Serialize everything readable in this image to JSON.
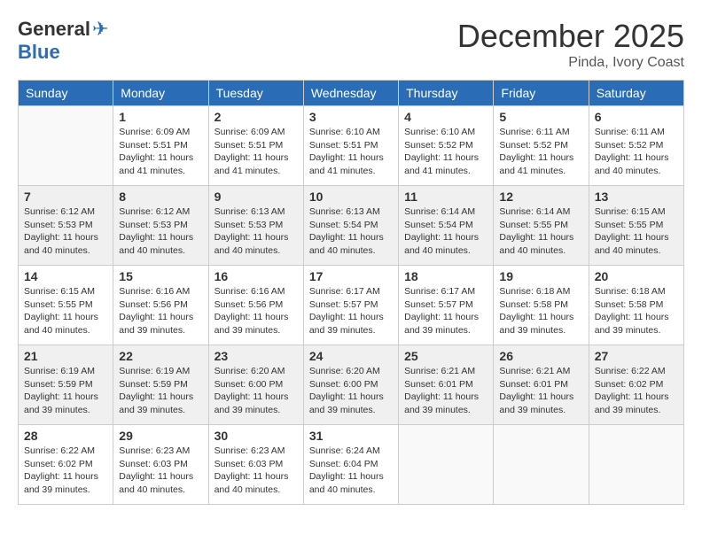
{
  "logo": {
    "general": "General",
    "blue": "Blue"
  },
  "title": "December 2025",
  "location": "Pinda, Ivory Coast",
  "days_header": [
    "Sunday",
    "Monday",
    "Tuesday",
    "Wednesday",
    "Thursday",
    "Friday",
    "Saturday"
  ],
  "weeks": [
    [
      {
        "num": "",
        "info": ""
      },
      {
        "num": "1",
        "info": "Sunrise: 6:09 AM\nSunset: 5:51 PM\nDaylight: 11 hours\nand 41 minutes."
      },
      {
        "num": "2",
        "info": "Sunrise: 6:09 AM\nSunset: 5:51 PM\nDaylight: 11 hours\nand 41 minutes."
      },
      {
        "num": "3",
        "info": "Sunrise: 6:10 AM\nSunset: 5:51 PM\nDaylight: 11 hours\nand 41 minutes."
      },
      {
        "num": "4",
        "info": "Sunrise: 6:10 AM\nSunset: 5:52 PM\nDaylight: 11 hours\nand 41 minutes."
      },
      {
        "num": "5",
        "info": "Sunrise: 6:11 AM\nSunset: 5:52 PM\nDaylight: 11 hours\nand 41 minutes."
      },
      {
        "num": "6",
        "info": "Sunrise: 6:11 AM\nSunset: 5:52 PM\nDaylight: 11 hours\nand 40 minutes."
      }
    ],
    [
      {
        "num": "7",
        "info": "Sunrise: 6:12 AM\nSunset: 5:53 PM\nDaylight: 11 hours\nand 40 minutes."
      },
      {
        "num": "8",
        "info": "Sunrise: 6:12 AM\nSunset: 5:53 PM\nDaylight: 11 hours\nand 40 minutes."
      },
      {
        "num": "9",
        "info": "Sunrise: 6:13 AM\nSunset: 5:53 PM\nDaylight: 11 hours\nand 40 minutes."
      },
      {
        "num": "10",
        "info": "Sunrise: 6:13 AM\nSunset: 5:54 PM\nDaylight: 11 hours\nand 40 minutes."
      },
      {
        "num": "11",
        "info": "Sunrise: 6:14 AM\nSunset: 5:54 PM\nDaylight: 11 hours\nand 40 minutes."
      },
      {
        "num": "12",
        "info": "Sunrise: 6:14 AM\nSunset: 5:55 PM\nDaylight: 11 hours\nand 40 minutes."
      },
      {
        "num": "13",
        "info": "Sunrise: 6:15 AM\nSunset: 5:55 PM\nDaylight: 11 hours\nand 40 minutes."
      }
    ],
    [
      {
        "num": "14",
        "info": "Sunrise: 6:15 AM\nSunset: 5:55 PM\nDaylight: 11 hours\nand 40 minutes."
      },
      {
        "num": "15",
        "info": "Sunrise: 6:16 AM\nSunset: 5:56 PM\nDaylight: 11 hours\nand 39 minutes."
      },
      {
        "num": "16",
        "info": "Sunrise: 6:16 AM\nSunset: 5:56 PM\nDaylight: 11 hours\nand 39 minutes."
      },
      {
        "num": "17",
        "info": "Sunrise: 6:17 AM\nSunset: 5:57 PM\nDaylight: 11 hours\nand 39 minutes."
      },
      {
        "num": "18",
        "info": "Sunrise: 6:17 AM\nSunset: 5:57 PM\nDaylight: 11 hours\nand 39 minutes."
      },
      {
        "num": "19",
        "info": "Sunrise: 6:18 AM\nSunset: 5:58 PM\nDaylight: 11 hours\nand 39 minutes."
      },
      {
        "num": "20",
        "info": "Sunrise: 6:18 AM\nSunset: 5:58 PM\nDaylight: 11 hours\nand 39 minutes."
      }
    ],
    [
      {
        "num": "21",
        "info": "Sunrise: 6:19 AM\nSunset: 5:59 PM\nDaylight: 11 hours\nand 39 minutes."
      },
      {
        "num": "22",
        "info": "Sunrise: 6:19 AM\nSunset: 5:59 PM\nDaylight: 11 hours\nand 39 minutes."
      },
      {
        "num": "23",
        "info": "Sunrise: 6:20 AM\nSunset: 6:00 PM\nDaylight: 11 hours\nand 39 minutes."
      },
      {
        "num": "24",
        "info": "Sunrise: 6:20 AM\nSunset: 6:00 PM\nDaylight: 11 hours\nand 39 minutes."
      },
      {
        "num": "25",
        "info": "Sunrise: 6:21 AM\nSunset: 6:01 PM\nDaylight: 11 hours\nand 39 minutes."
      },
      {
        "num": "26",
        "info": "Sunrise: 6:21 AM\nSunset: 6:01 PM\nDaylight: 11 hours\nand 39 minutes."
      },
      {
        "num": "27",
        "info": "Sunrise: 6:22 AM\nSunset: 6:02 PM\nDaylight: 11 hours\nand 39 minutes."
      }
    ],
    [
      {
        "num": "28",
        "info": "Sunrise: 6:22 AM\nSunset: 6:02 PM\nDaylight: 11 hours\nand 39 minutes."
      },
      {
        "num": "29",
        "info": "Sunrise: 6:23 AM\nSunset: 6:03 PM\nDaylight: 11 hours\nand 40 minutes."
      },
      {
        "num": "30",
        "info": "Sunrise: 6:23 AM\nSunset: 6:03 PM\nDaylight: 11 hours\nand 40 minutes."
      },
      {
        "num": "31",
        "info": "Sunrise: 6:24 AM\nSunset: 6:04 PM\nDaylight: 11 hours\nand 40 minutes."
      },
      {
        "num": "",
        "info": ""
      },
      {
        "num": "",
        "info": ""
      },
      {
        "num": "",
        "info": ""
      }
    ]
  ]
}
